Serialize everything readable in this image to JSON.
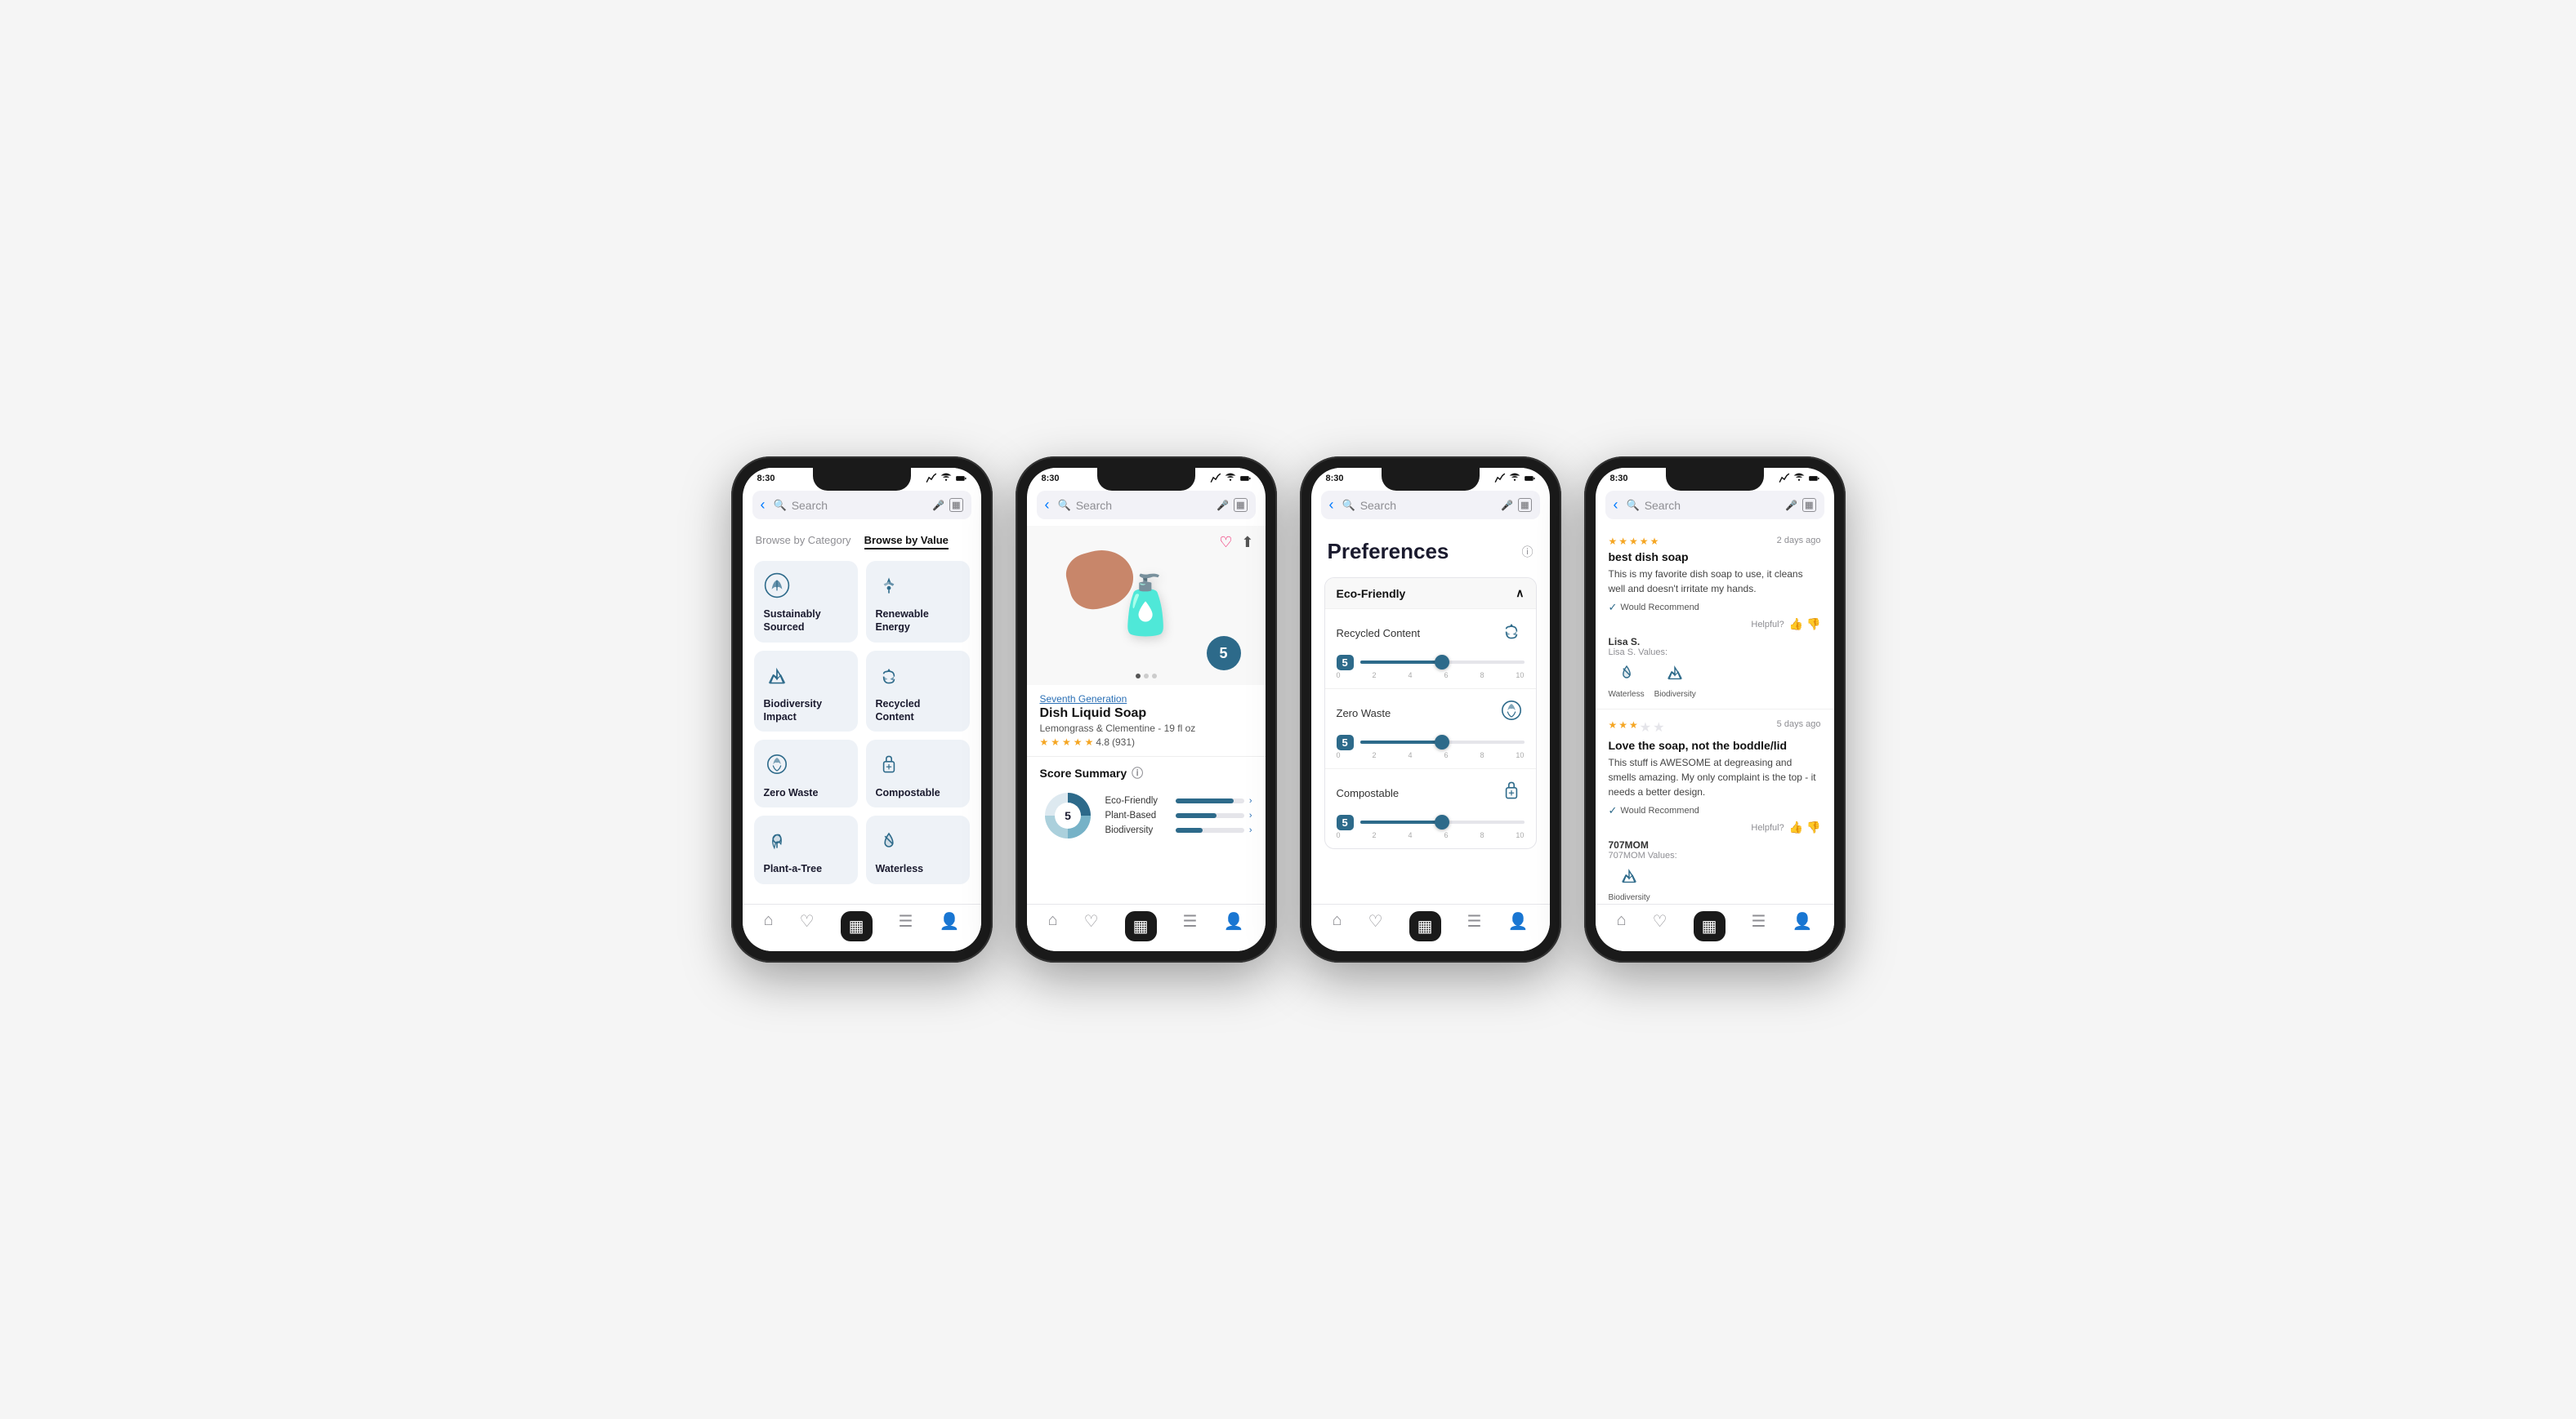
{
  "phones": [
    {
      "id": "phone1",
      "time": "8:30",
      "search_placeholder": "Search",
      "tabs": [
        "Browse by Category",
        "Browse by Value"
      ],
      "active_tab": 1,
      "categories": [
        {
          "id": "sustainably-sourced",
          "label": "Sustainably Sourced",
          "icon": "leaf"
        },
        {
          "id": "renewable-energy",
          "label": "Renewable Energy",
          "icon": "wind"
        },
        {
          "id": "biodiversity-impact",
          "label": "Biodiversity Impact",
          "icon": "tree"
        },
        {
          "id": "recycled-content",
          "label": "Recycled Content",
          "icon": "recycle"
        },
        {
          "id": "zero-waste",
          "label": "Zero Waste",
          "icon": "globe"
        },
        {
          "id": "compostable",
          "label": "Compostable",
          "icon": "package"
        },
        {
          "id": "plant-a-tree",
          "label": "Plant-a-Tree",
          "icon": "plant"
        },
        {
          "id": "waterless",
          "label": "Waterless",
          "icon": "water"
        }
      ],
      "nav": [
        "home",
        "heart",
        "scan",
        "list",
        "person"
      ]
    },
    {
      "id": "phone2",
      "time": "8:30",
      "search_placeholder": "Search",
      "product": {
        "brand": "Seventh Generation",
        "name": "Dish Liquid Soap",
        "description": "Lemongrass & Clementine - 19 fl oz",
        "rating": "4.8",
        "reviews": "(931)",
        "score": "5"
      },
      "score_summary": {
        "title": "Score Summary",
        "total": "5",
        "bars": [
          {
            "label": "Eco-Friendly",
            "fill": 85
          },
          {
            "label": "Plant-Based",
            "fill": 60
          },
          {
            "label": "Biodiversity",
            "fill": 40
          }
        ]
      },
      "nav": [
        "home",
        "heart",
        "scan",
        "list",
        "person"
      ]
    },
    {
      "id": "phone3",
      "time": "8:30",
      "search_placeholder": "Search",
      "preferences": {
        "title": "Preferences",
        "section": "Eco-Friendly",
        "items": [
          {
            "label": "Recycled Content",
            "score": "5",
            "icon": "recycle",
            "fill_pct": 50,
            "ticks": [
              "0",
              "2",
              "4",
              "6",
              "8",
              "10"
            ]
          },
          {
            "label": "Zero Waste",
            "score": "5",
            "icon": "globe",
            "fill_pct": 50,
            "ticks": [
              "0",
              "2",
              "4",
              "6",
              "8",
              "10"
            ]
          },
          {
            "label": "Compostable",
            "score": "5",
            "icon": "package",
            "fill_pct": 50,
            "ticks": [
              "0",
              "2",
              "4",
              "6",
              "8",
              "10"
            ]
          }
        ]
      },
      "nav": [
        "home",
        "heart",
        "scan",
        "list",
        "person"
      ]
    },
    {
      "id": "phone4",
      "time": "8:30",
      "search_placeholder": "Search",
      "reviews": [
        {
          "stars": 5,
          "time_ago": "2 days ago",
          "title": "best dish soap",
          "body": "This is my favorite dish soap to use, it cleans well and doesn't irritate my hands.",
          "recommend": "Would Recommend",
          "helpful_label": "Helpful?",
          "author": "Lisa S.",
          "values_label": "Lisa S. Values:",
          "values": [
            {
              "icon": "water",
              "label": "Waterless"
            },
            {
              "icon": "tree",
              "label": "Biodiversity"
            }
          ]
        },
        {
          "stars": 3,
          "time_ago": "5 days ago",
          "title": "Love the soap, not the boddle/lid",
          "body": "This stuff is AWESOME at degreasing and smells amazing. My only complaint is the top - it needs a better design.",
          "recommend": "Would Recommend",
          "helpful_label": "Helpful?",
          "author": "707MOM",
          "values_label": "707MOM Values:",
          "values": [
            {
              "icon": "tree",
              "label": "Biodiversity"
            }
          ]
        }
      ],
      "nav": [
        "home",
        "heart",
        "scan",
        "list",
        "person"
      ]
    }
  ]
}
